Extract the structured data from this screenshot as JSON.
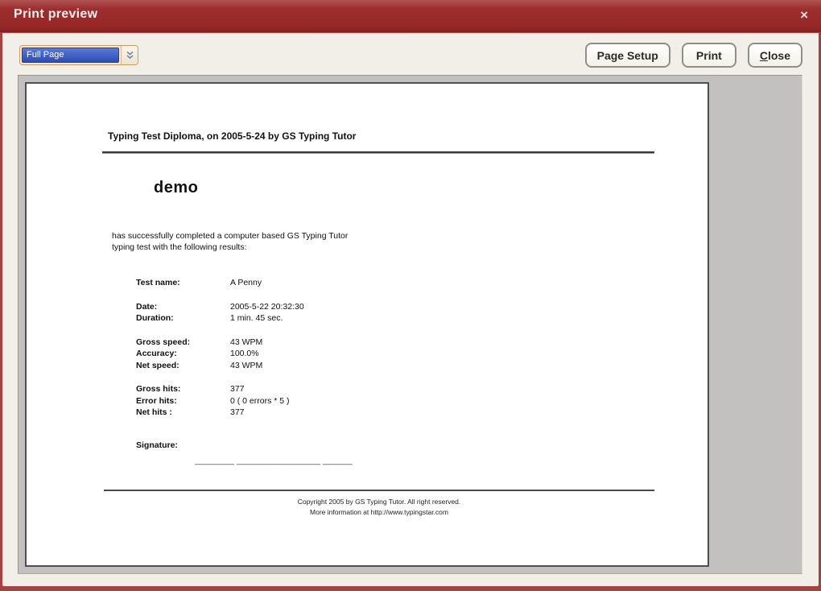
{
  "window": {
    "title": "Print preview",
    "close_glyph": "×"
  },
  "toolbar": {
    "zoom_value": "Full Page",
    "page_setup_label": "Page Setup",
    "print_label": "Print",
    "close_initial": "C",
    "close_rest": "lose"
  },
  "colors": {
    "titlebar_red": "#9b2c2c",
    "selection_blue": "#3352b8",
    "preview_gray": "#c2c1bf",
    "combo_border_tan": "#c79e64"
  },
  "document": {
    "header": "Typing Test Diploma, on 2005-5-24 by GS Typing Tutor",
    "recipient": "demo",
    "intro_line1": "has successfully completed a computer based GS Typing Tutor",
    "intro_line2": "typing test with the following results:",
    "result_groups": [
      [
        {
          "label": "Test name:",
          "value": "A Penny"
        }
      ],
      [
        {
          "label": "Date:",
          "value": "2005-5-22 20:32:30"
        },
        {
          "label": "Duration:",
          "value": "1 min. 45 sec."
        }
      ],
      [
        {
          "label": "Gross speed:",
          "value": "43 WPM"
        },
        {
          "label": "Accuracy:",
          "value": "100.0%"
        },
        {
          "label": "Net speed:",
          "value": "43 WPM"
        }
      ],
      [
        {
          "label": "Gross hits:",
          "value": "377"
        },
        {
          "label": "Error hits:",
          "value": "0 ( 0 errors * 5 )"
        },
        {
          "label": "Net hits :",
          "value": "377"
        }
      ]
    ],
    "signature_label": "Signature:",
    "signature_line": "________ _________________ ______",
    "footer_line1": "Copyright 2005 by GS Typing Tutor. All right reserved.",
    "footer_line2": "More information at http://www.typingstar.com"
  }
}
